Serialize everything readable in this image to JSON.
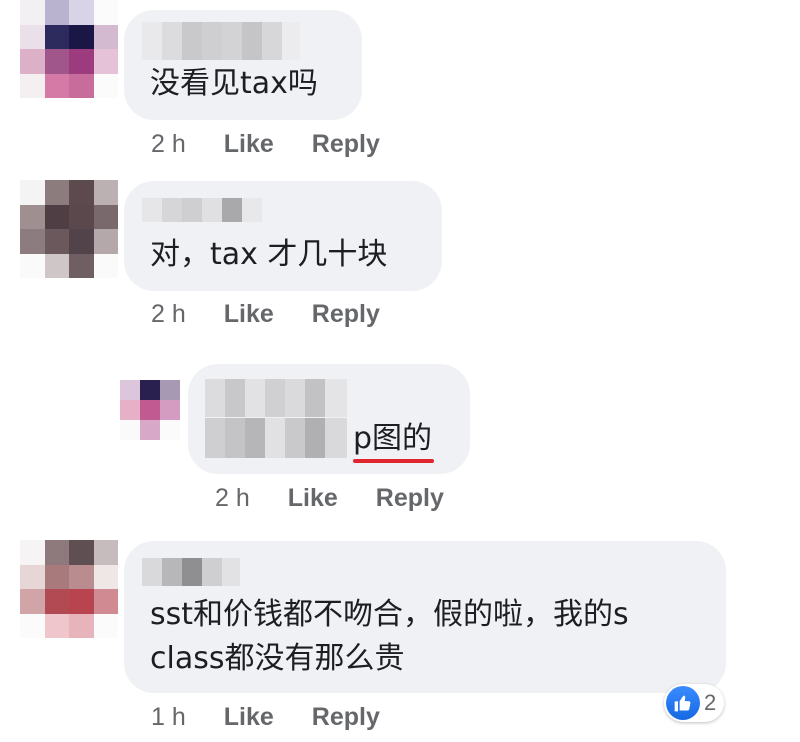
{
  "labels": {
    "like": "Like",
    "reply": "Reply"
  },
  "comments": [
    {
      "text": "没看见tax吗",
      "time": "2 h"
    },
    {
      "text": "对，tax 才几十块",
      "time": "2 h"
    },
    {
      "text": "p图的",
      "time": "2 h",
      "is_reply": true
    },
    {
      "text_line1": "sst和价钱都不吻合，假的啦，我的s",
      "text_line2": "class都没有那么贵",
      "time": "1 h",
      "reaction_count": "2"
    }
  ],
  "colors": {
    "bubble": "#f0f1f4",
    "meta": "#65676b",
    "text": "#1c1e21",
    "underline": "#e0262f",
    "like_blue": "#1877f2"
  }
}
